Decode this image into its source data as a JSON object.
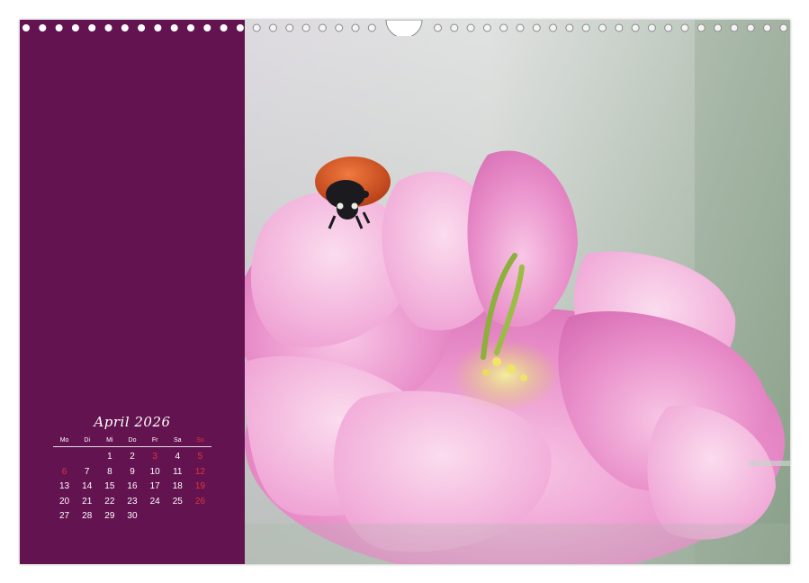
{
  "calendar": {
    "title": "April 2026",
    "weekdays": [
      "Mo",
      "Di",
      "Mi",
      "Do",
      "Fr",
      "Sa",
      "So"
    ],
    "weeks": [
      [
        "",
        "",
        "1",
        "2",
        "3",
        "4",
        "5"
      ],
      [
        "6",
        "7",
        "8",
        "9",
        "10",
        "11",
        "12"
      ],
      [
        "13",
        "14",
        "15",
        "16",
        "17",
        "18",
        "19"
      ],
      [
        "20",
        "21",
        "22",
        "23",
        "24",
        "25",
        "26"
      ],
      [
        "27",
        "28",
        "29",
        "30",
        "",
        "",
        ""
      ]
    ],
    "holidays": [
      "3",
      "6"
    ]
  },
  "colors": {
    "panel": "#63134f",
    "holiday": "#e0343e",
    "text": "#ffffff"
  }
}
